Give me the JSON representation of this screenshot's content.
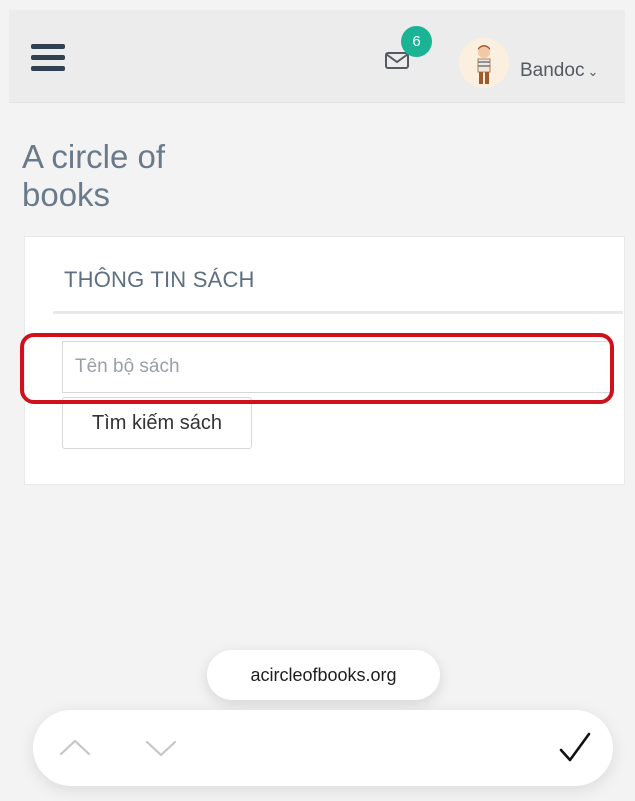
{
  "header": {
    "notification_count": "6",
    "user_name": "Bandoc",
    "menu_icon": "hamburger-icon",
    "mail_icon": "envelope-icon",
    "dropdown_icon": "chevron-down-icon",
    "badge_color": "#1ab394"
  },
  "page": {
    "title": "A circle of books"
  },
  "card": {
    "title": "THÔNG TIN SÁCH",
    "search_placeholder": "Tên bộ sách",
    "search_button": "Tìm kiếm sách"
  },
  "browser": {
    "url": "acircleofbooks.org",
    "up_icon": "chevron-up-icon",
    "down_icon": "chevron-down-icon",
    "done_icon": "checkmark-icon"
  },
  "annotation": {
    "color": "#d0101a"
  }
}
